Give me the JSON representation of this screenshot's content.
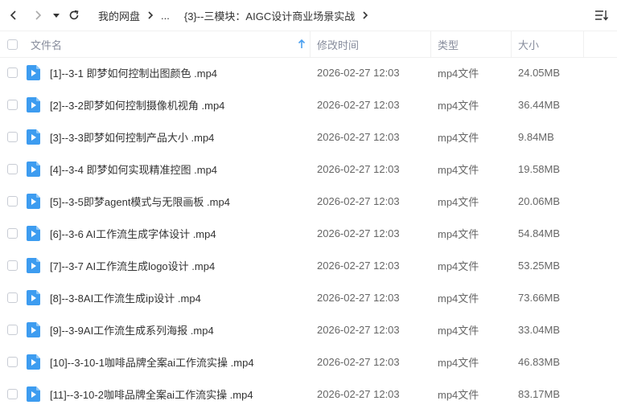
{
  "toolbar": {
    "breadcrumb": [
      "我的网盘",
      "...",
      "{3}--三模块：AIGC设计商业场景实战"
    ]
  },
  "columns": {
    "name": "文件名",
    "time": "修改时间",
    "type": "类型",
    "size": "大小"
  },
  "files": [
    {
      "name": "[1]--3-1 即梦如何控制出图颜色 .mp4",
      "time": "2026-02-27 12:03",
      "type": "mp4文件",
      "size": "24.05MB"
    },
    {
      "name": "[2]--3-2即梦如何控制摄像机视角 .mp4",
      "time": "2026-02-27 12:03",
      "type": "mp4文件",
      "size": "36.44MB"
    },
    {
      "name": "[3]--3-3即梦如何控制产品大小 .mp4",
      "time": "2026-02-27 12:03",
      "type": "mp4文件",
      "size": "9.84MB"
    },
    {
      "name": "[4]--3-4 即梦如何实现精准控图 .mp4",
      "time": "2026-02-27 12:03",
      "type": "mp4文件",
      "size": "19.58MB"
    },
    {
      "name": "[5]--3-5即梦agent模式与无限画板 .mp4",
      "time": "2026-02-27 12:03",
      "type": "mp4文件",
      "size": "20.06MB"
    },
    {
      "name": "[6]--3-6 AI工作流生成字体设计 .mp4",
      "time": "2026-02-27 12:03",
      "type": "mp4文件",
      "size": "54.84MB"
    },
    {
      "name": "[7]--3-7 AI工作流生成logo设计 .mp4",
      "time": "2026-02-27 12:03",
      "type": "mp4文件",
      "size": "53.25MB"
    },
    {
      "name": "[8]--3-8AI工作流生成ip设计 .mp4",
      "time": "2026-02-27 12:03",
      "type": "mp4文件",
      "size": "73.66MB"
    },
    {
      "name": "[9]--3-9AI工作流生成系列海报 .mp4",
      "time": "2026-02-27 12:03",
      "type": "mp4文件",
      "size": "33.04MB"
    },
    {
      "name": "[10]--3-10-1咖啡品牌全案ai工作流实操 .mp4",
      "time": "2026-02-27 12:03",
      "type": "mp4文件",
      "size": "46.83MB"
    },
    {
      "name": "[11]--3-10-2咖啡品牌全案ai工作流实操 .mp4",
      "time": "2026-02-27 12:03",
      "type": "mp4文件",
      "size": "83.17MB"
    }
  ],
  "colors": {
    "accent": "#4a9fef",
    "file_icon": "#3d9cf0",
    "header_text": "#878c9c",
    "border": "#f0f0f0"
  }
}
